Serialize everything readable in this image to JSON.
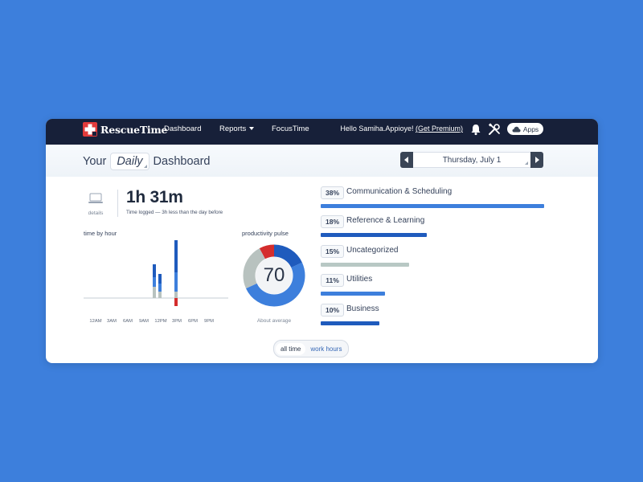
{
  "nav": {
    "brand": "RescueTime",
    "links": [
      "Dashboard",
      "Reports",
      "FocusTime"
    ],
    "greeting": "Hello Samiha.Appioye!",
    "premium_link": "(Get Premium)",
    "apps_label": "Apps",
    "icons": [
      "bell-icon",
      "tools-icon",
      "cloud-icon"
    ]
  },
  "header": {
    "title_prefix": "Your",
    "period": "Daily",
    "title_suffix": "Dashboard",
    "date": "Thursday, July 1"
  },
  "summary": {
    "details_label": "details",
    "total_time": "1h 31m",
    "subtitle": "Time logged — 3h less than the day before"
  },
  "time_by_hour": {
    "label": "time by hour",
    "ticks": [
      "12AM",
      "3AM",
      "6AM",
      "9AM",
      "12PM",
      "3PM",
      "6PM",
      "9PM"
    ],
    "colors": {
      "very_productive": "#1f5bbd",
      "productive": "#3d7fdc",
      "neutral": "#b8c2bf",
      "distracting": "#d42d2d"
    }
  },
  "productivity_pulse": {
    "label": "productivity pulse",
    "score": "70",
    "note": "About average",
    "segments": [
      {
        "color": "#1f5bbd",
        "fraction": 0.18
      },
      {
        "color": "#3d7fdc",
        "fraction": 0.5
      },
      {
        "color": "#b8c2bf",
        "fraction": 0.24
      },
      {
        "color": "#d42d2d",
        "fraction": 0.08
      }
    ]
  },
  "categories": [
    {
      "percent": "38%",
      "name": "Communication & Scheduling",
      "value": 38,
      "color": "#3d7fdc"
    },
    {
      "percent": "18%",
      "name": "Reference & Learning",
      "value": 18,
      "color": "#1f5bbd"
    },
    {
      "percent": "15%",
      "name": "Uncategorized",
      "value": 15,
      "color": "#b8c8c4"
    },
    {
      "percent": "11%",
      "name": "Utilities",
      "value": 11,
      "color": "#3d7fdc"
    },
    {
      "percent": "10%",
      "name": "Business",
      "value": 10,
      "color": "#1f5bbd"
    }
  ],
  "toggle": {
    "all_time": "all time",
    "work_hours": "work hours"
  }
}
